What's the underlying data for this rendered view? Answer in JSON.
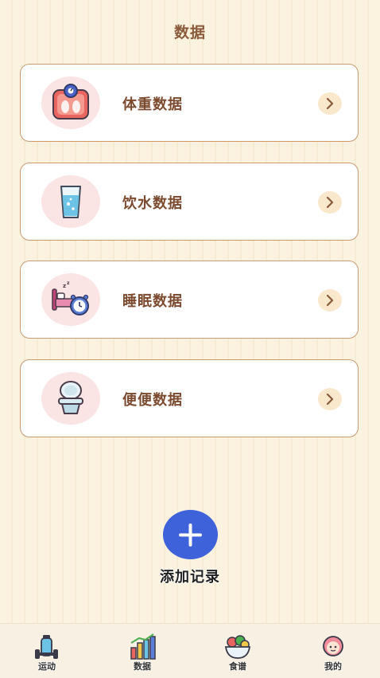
{
  "header": {
    "title": "数据"
  },
  "cards": [
    {
      "label": "体重数据",
      "icon": "scale-icon"
    },
    {
      "label": "饮水数据",
      "icon": "water-glass-icon"
    },
    {
      "label": "睡眠数据",
      "icon": "sleep-icon"
    },
    {
      "label": "便便数据",
      "icon": "toilet-icon"
    }
  ],
  "add": {
    "label": "添加记录",
    "icon": "plus-icon"
  },
  "tabbar": {
    "items": [
      {
        "label": "运动",
        "icon": "sport-icon"
      },
      {
        "label": "数据",
        "icon": "chart-icon"
      },
      {
        "label": "食谱",
        "icon": "food-icon"
      },
      {
        "label": "我的",
        "icon": "profile-icon"
      }
    ]
  },
  "colors": {
    "accent": "#3d62d9",
    "text": "#7c4b2f",
    "card_border": "#c99a74"
  }
}
